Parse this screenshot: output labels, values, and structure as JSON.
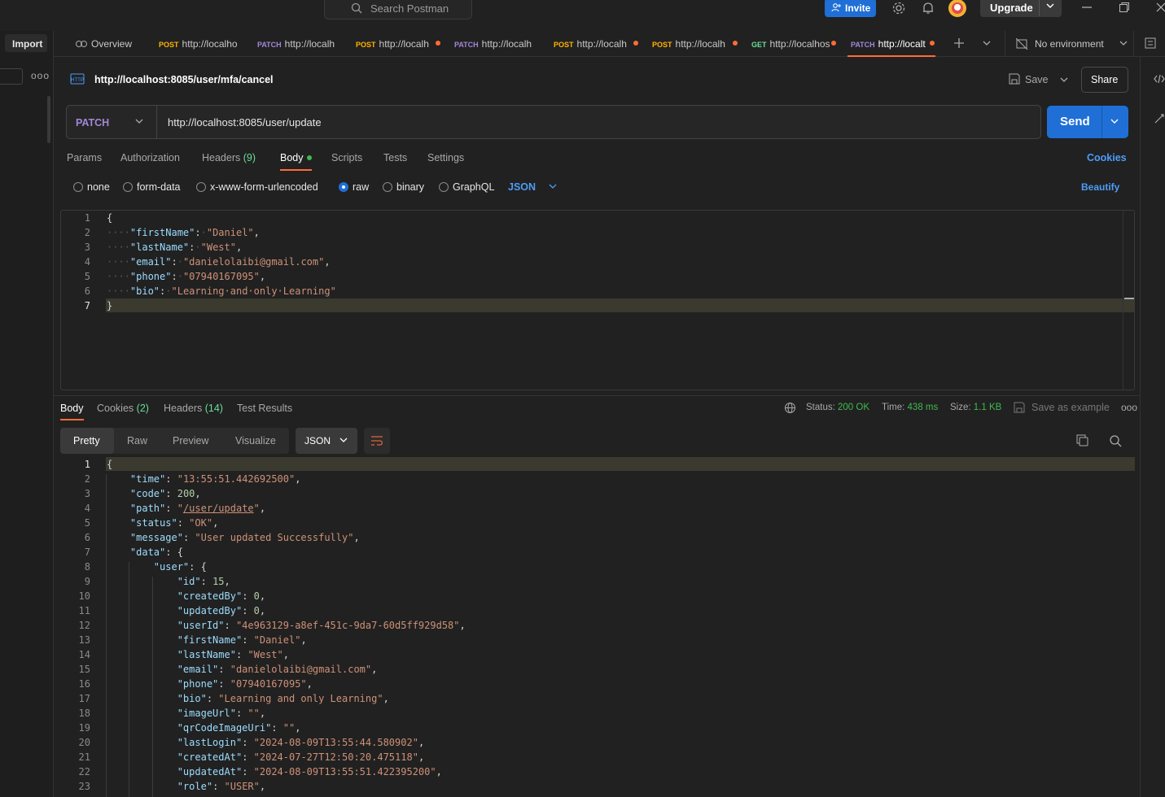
{
  "topbar": {
    "search_placeholder": "Search Postman",
    "invite_label": "Invite",
    "upgrade_label": "Upgrade"
  },
  "sidebar": {
    "import_label": "Import",
    "more": "ooo"
  },
  "tabs": {
    "overview": "Overview",
    "items": [
      {
        "method": "POST",
        "label": "http://localho",
        "dot": false
      },
      {
        "method": "PATCH",
        "label": "http://localh",
        "dot": false
      },
      {
        "method": "POST",
        "label": "http://localh",
        "dot": true
      },
      {
        "method": "PATCH",
        "label": "http://localh",
        "dot": false
      },
      {
        "method": "POST",
        "label": "http://localh",
        "dot": true
      },
      {
        "method": "POST",
        "label": "http://localh",
        "dot": true
      },
      {
        "method": "GET",
        "label": "http://localhos",
        "dot": true
      },
      {
        "method": "PATCH",
        "label": "http://localt",
        "dot": true
      }
    ],
    "environment": "No environment"
  },
  "request": {
    "title": "http://localhost:8085/user/mfa/cancel",
    "save_label": "Save",
    "share_label": "Share",
    "method": "PATCH",
    "url": "http://localhost:8085/user/update",
    "send_label": "Send",
    "tabs": {
      "params": "Params",
      "authorization": "Authorization",
      "headers": "Headers",
      "headers_count": "(9)",
      "body": "Body",
      "scripts": "Scripts",
      "tests": "Tests",
      "settings": "Settings"
    },
    "cookies_label": "Cookies",
    "body_types": [
      "none",
      "form-data",
      "x-www-form-urlencoded",
      "raw",
      "binary",
      "GraphQL"
    ],
    "body_format": "JSON",
    "beautify_label": "Beautify",
    "line_numbers": [
      "1",
      "2",
      "3",
      "4",
      "5",
      "6",
      "7"
    ],
    "body_lines": [
      "{",
      "····\"firstName\":·\"Daniel\",",
      "····\"lastName\":·\"West\",",
      "····\"email\":·\"danielolaibi@gmail.com\",",
      "····\"phone\":·\"07940167095\",",
      "····\"bio\":·\"Learning·and·only·Learning\"",
      "}"
    ]
  },
  "response": {
    "tabs": {
      "body": "Body",
      "cookies": "Cookies",
      "cookies_count": "(2)",
      "headers": "Headers",
      "headers_count": "(14)",
      "test_results": "Test Results"
    },
    "status_label": "Status:",
    "status_value": "200 OK",
    "time_label": "Time:",
    "time_value": "438 ms",
    "size_label": "Size:",
    "size_value": "1.1 KB",
    "save_example_label": "Save as example",
    "views": [
      "Pretty",
      "Raw",
      "Preview",
      "Visualize"
    ],
    "format": "JSON",
    "line_numbers": [
      "1",
      "2",
      "3",
      "4",
      "5",
      "6",
      "7",
      "8",
      "9",
      "10",
      "11",
      "12",
      "13",
      "14",
      "15",
      "16",
      "17",
      "18",
      "19",
      "20",
      "21",
      "22",
      "23"
    ],
    "body_lines": [
      "{",
      "    \"time\": \"13:55:51.442692500\",",
      "    \"code\": 200,",
      "    \"path\": \"/user/update\",",
      "    \"status\": \"OK\",",
      "    \"message\": \"User updated Successfully\",",
      "    \"data\": {",
      "        \"user\": {",
      "            \"id\": 15,",
      "            \"createdBy\": 0,",
      "            \"updatedBy\": 0,",
      "            \"userId\": \"4e963129-a8ef-451c-9da7-60d5ff929d58\",",
      "            \"firstName\": \"Daniel\",",
      "            \"lastName\": \"West\",",
      "            \"email\": \"danielolaibi@gmail.com\",",
      "            \"phone\": \"07940167095\",",
      "            \"bio\": \"Learning and only Learning\",",
      "            \"imageUrl\": \"\",",
      "            \"qrCodeImageUri\": \"\",",
      "            \"lastLogin\": \"2024-08-09T13:55:44.580902\",",
      "            \"createdAt\": \"2024-07-27T12:50:20.475118\",",
      "            \"updatedAt\": \"2024-08-09T13:55:51.422395200\",",
      "            \"role\": \"USER\","
    ]
  }
}
